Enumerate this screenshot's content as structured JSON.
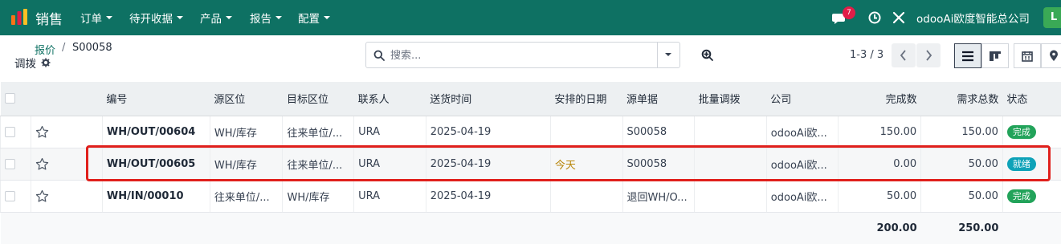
{
  "topbar": {
    "app_name": "销售",
    "menus": [
      "订单",
      "待开收据",
      "产品",
      "报告",
      "配置"
    ],
    "chat_badge": "7",
    "company": "odooAi欧度智能总公司",
    "avatar_initial": "L",
    "colors": {
      "bar": "#0e7163",
      "badge": "#e11d48",
      "avatar": "#3aa956"
    }
  },
  "control": {
    "breadcrumb_parent": "报价",
    "breadcrumb_sep": "/",
    "breadcrumb_current": "S00058",
    "page_title": "调拨",
    "search_placeholder": "搜索...",
    "pager": "1-3 / 3",
    "prev": "‹",
    "next": "›"
  },
  "table": {
    "columns": [
      "编号",
      "源区位",
      "目标区位",
      "联系人",
      "送货时间",
      "安排的日期",
      "源单据",
      "批量调拨",
      "公司",
      "完成数",
      "需求总数",
      "状态"
    ],
    "rows": [
      {
        "ref": "WH/OUT/00604",
        "src": "WH/库存",
        "dest": "往来单位/...",
        "contact": "URA",
        "delivery": "2025-04-19",
        "scheduled": "",
        "origin": "S00058",
        "batch": "",
        "company": "odooAi欧...",
        "done": "150.00",
        "demand": "150.00",
        "state": "完成",
        "state_kind": "done"
      },
      {
        "ref": "WH/OUT/00605",
        "src": "WH/库存",
        "dest": "往来单位/...",
        "contact": "URA",
        "delivery": "2025-04-19",
        "scheduled": "今天",
        "origin": "S00058",
        "batch": "",
        "company": "odooAi欧...",
        "done": "0.00",
        "demand": "50.00",
        "state": "就绪",
        "state_kind": "ready"
      },
      {
        "ref": "WH/IN/00010",
        "src": "往来单位/...",
        "dest": "WH/库存",
        "contact": "URA",
        "delivery": "2025-04-19",
        "scheduled": "",
        "origin": "退回WH/O...",
        "batch": "",
        "company": "odooAi欧...",
        "done": "50.00",
        "demand": "50.00",
        "state": "完成",
        "state_kind": "done"
      }
    ],
    "totals": {
      "done": "200.00",
      "demand": "250.00"
    }
  }
}
